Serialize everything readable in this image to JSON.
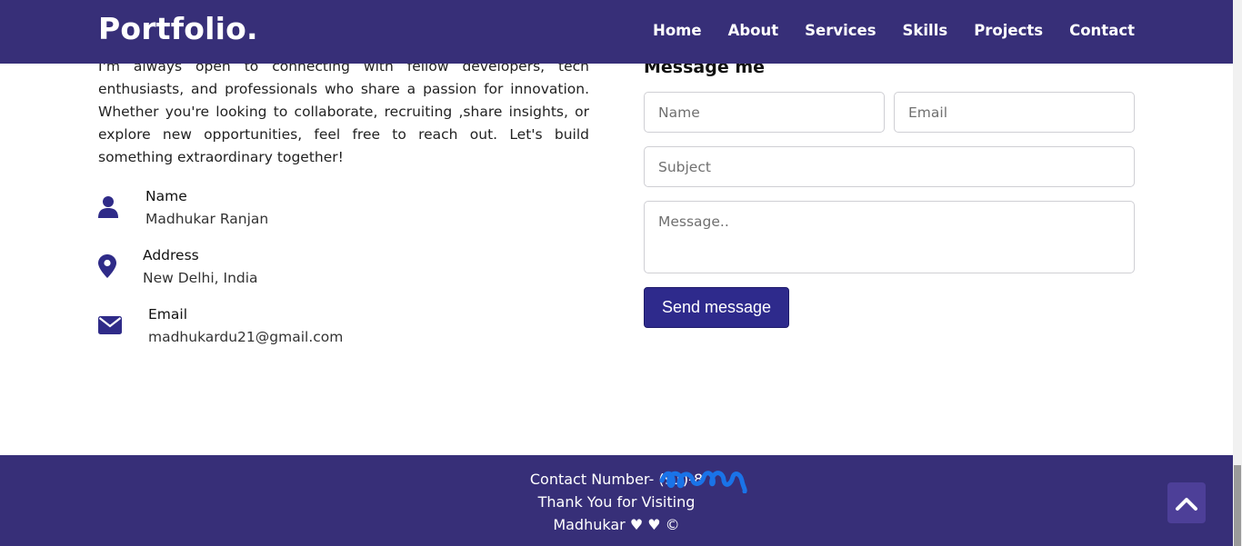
{
  "header": {
    "logo": "Portfolio.",
    "nav": [
      "Home",
      "About",
      "Services",
      "Skills",
      "Projects",
      "Contact"
    ]
  },
  "contact": {
    "intro": "I'm always open to connecting with fellow developers, tech enthusiasts, and professionals who share a passion for innovation. Whether you're looking to collaborate, recruiting ,share insights, or explore new opportunities, feel free to reach out. Let's build something extraordinary together!",
    "name_label": "Name",
    "name_value": "Madhukar Ranjan",
    "address_label": "Address",
    "address_value": "New Delhi, India",
    "email_label": "Email",
    "email_value": "madhukardu21@gmail.com"
  },
  "form": {
    "title": "Message me",
    "name_placeholder": "Name",
    "email_placeholder": "Email",
    "subject_placeholder": "Subject",
    "message_placeholder": "Message..",
    "submit_label": "Send message"
  },
  "footer": {
    "contact_number": "Contact Number- (91)-8",
    "thanks": "Thank You for Visiting",
    "credit": "Madhukar ♥ ♥ ©"
  },
  "colors": {
    "brand": "#372f78",
    "button": "#2e2a8c",
    "icon": "#2f2b88",
    "scribble": "#1a73e8"
  },
  "icons": {
    "user": "user-icon",
    "location": "map-marker-icon",
    "envelope": "envelope-icon",
    "chevron": "chevron-up-icon"
  }
}
